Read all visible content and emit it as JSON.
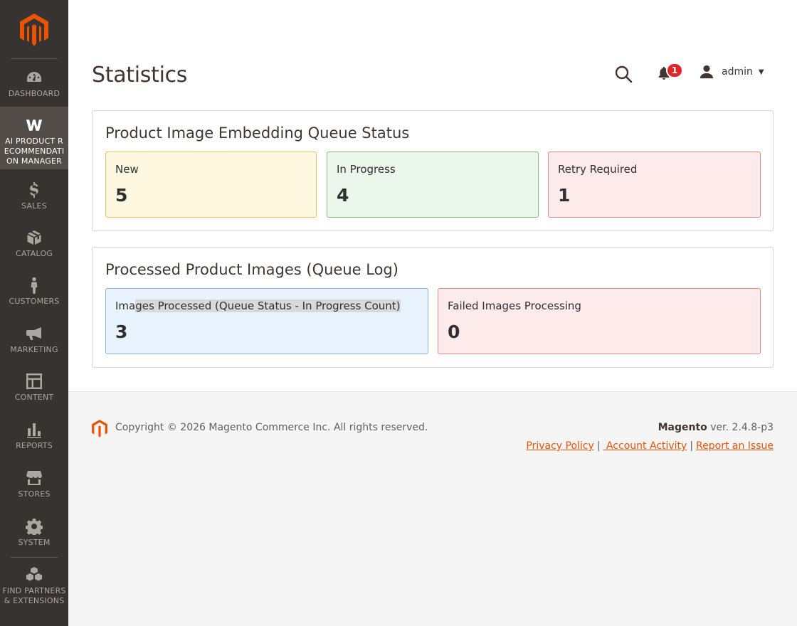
{
  "sidebar": {
    "items": [
      {
        "label": "DASHBOARD",
        "icon": "dashboard-icon"
      },
      {
        "label": "AI PRODUCT RECOMMENDATION MANAGER",
        "icon": "ai-logo-icon"
      },
      {
        "label": "SALES",
        "icon": "dollar-icon"
      },
      {
        "label": "CATALOG",
        "icon": "box-icon"
      },
      {
        "label": "CUSTOMERS",
        "icon": "person-icon"
      },
      {
        "label": "MARKETING",
        "icon": "megaphone-icon"
      },
      {
        "label": "CONTENT",
        "icon": "layout-icon"
      },
      {
        "label": "REPORTS",
        "icon": "bar-chart-icon"
      },
      {
        "label": "STORES",
        "icon": "storefront-icon"
      },
      {
        "label": "SYSTEM",
        "icon": "gear-icon"
      },
      {
        "label": "FIND PARTNERS & EXTENSIONS",
        "icon": "cubes-icon"
      }
    ],
    "active_index": 1
  },
  "header": {
    "title": "Statistics",
    "notification_count": "1",
    "user": "admin"
  },
  "queue_status": {
    "title": "Product Image Embedding Queue Status",
    "cards": [
      {
        "label": "New",
        "value": "5"
      },
      {
        "label": "In Progress",
        "value": "4"
      },
      {
        "label": "Retry Required",
        "value": "1"
      }
    ]
  },
  "queue_log": {
    "title": "Processed Product Images (Queue Log)",
    "processed": {
      "label_prefix": "Ima",
      "label_highlight": "ges Processed (Queue Status - In Progress Count)",
      "value": "3"
    },
    "failed": {
      "label": "Failed Images Processing",
      "value": "0"
    }
  },
  "footer": {
    "copyright": "Copyright © 2026 Magento Commerce Inc. All rights reserved.",
    "brand": "Magento",
    "version": " ver. 2.4.8-p3",
    "links": [
      "Privacy Policy",
      " Account Activity",
      "Report an Issue"
    ],
    "separator": "|"
  },
  "colors": {
    "sidebar": "#373330",
    "accent": "#eb5202",
    "badge": "#e22626"
  }
}
